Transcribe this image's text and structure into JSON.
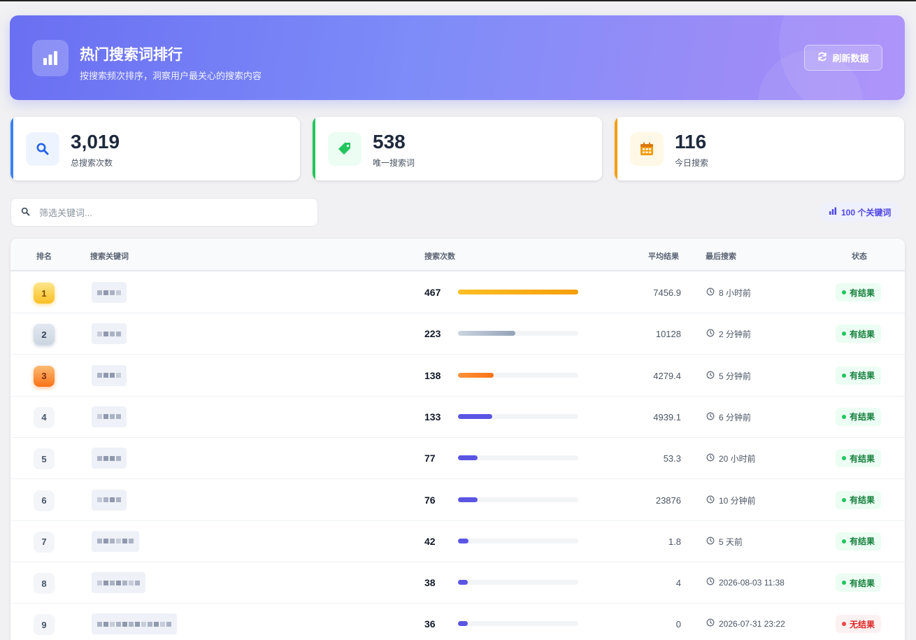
{
  "header": {
    "title": "热门搜索词排行",
    "subtitle": "按搜索频次排序，洞察用户最关心的搜索内容",
    "refresh_label": "刷新数据",
    "icon": "bar-chart-icon"
  },
  "stats": [
    {
      "value": "3,019",
      "label": "总搜索次数",
      "icon": "search-icon",
      "accent": "#3b82f6"
    },
    {
      "value": "538",
      "label": "唯一搜索词",
      "icon": "tag-icon",
      "accent": "#22c55e"
    },
    {
      "value": "116",
      "label": "今日搜索",
      "icon": "calendar-icon",
      "accent": "#f59e0b"
    }
  ],
  "search": {
    "placeholder": "筛选关键词..."
  },
  "keyword_count": "100 个关键词",
  "table": {
    "headers": {
      "rank": "排名",
      "keyword": "搜索关键词",
      "count": "搜索次数",
      "avg": "平均结果",
      "last": "最后搜索",
      "status": "状态"
    },
    "max_count": 467,
    "rows": [
      {
        "rank": "1",
        "count": "467",
        "count_num": 467,
        "avg": "7456.9",
        "last": "8 小时前",
        "status": "有结果",
        "has_result": true
      },
      {
        "rank": "2",
        "count": "223",
        "count_num": 223,
        "avg": "10128",
        "last": "2 分钟前",
        "status": "有结果",
        "has_result": true
      },
      {
        "rank": "3",
        "count": "138",
        "count_num": 138,
        "avg": "4279.4",
        "last": "5 分钟前",
        "status": "有结果",
        "has_result": true
      },
      {
        "rank": "4",
        "count": "133",
        "count_num": 133,
        "avg": "4939.1",
        "last": "6 分钟前",
        "status": "有结果",
        "has_result": true
      },
      {
        "rank": "5",
        "count": "77",
        "count_num": 77,
        "avg": "53.3",
        "last": "20 小时前",
        "status": "有结果",
        "has_result": true
      },
      {
        "rank": "6",
        "count": "76",
        "count_num": 76,
        "avg": "23876",
        "last": "10 分钟前",
        "status": "有结果",
        "has_result": true
      },
      {
        "rank": "7",
        "count": "42",
        "count_num": 42,
        "avg": "1.8",
        "last": "5 天前",
        "status": "有结果",
        "has_result": true
      },
      {
        "rank": "8",
        "count": "38",
        "count_num": 38,
        "avg": "4",
        "last": "2026-08-03 11:38",
        "status": "有结果",
        "has_result": true
      },
      {
        "rank": "9",
        "count": "36",
        "count_num": 36,
        "avg": "0",
        "last": "2026-07-31 23:22",
        "status": "无结果",
        "has_result": false
      }
    ]
  }
}
